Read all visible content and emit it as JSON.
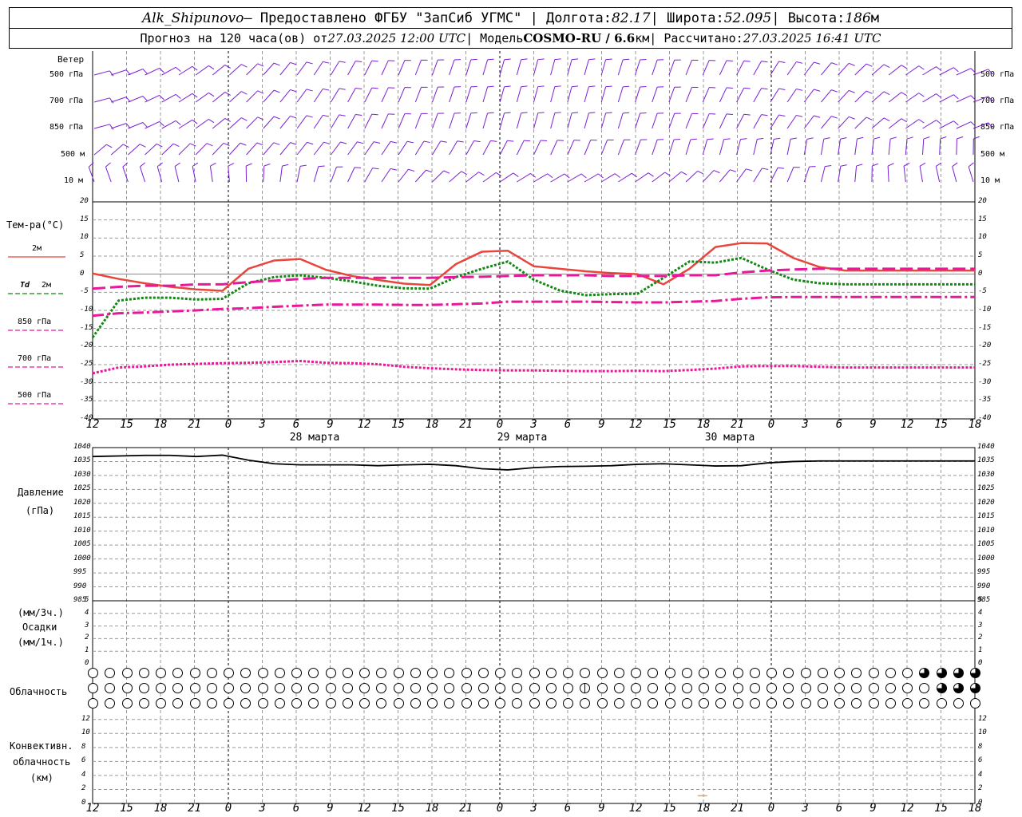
{
  "header": {
    "station": "Alk_Shipunovo",
    "provider": " – Предоставлено ФГБУ \"ЗапСиб УГМС\" | Долгота: ",
    "lon": "82.17",
    "lat_label": " | Широта: ",
    "lat": "52.095",
    "alt_label": " | Высота: ",
    "alt": "186",
    "alt_unit": "м",
    "forecast_label": "Прогноз на 120 часа(ов) от ",
    "forecast_time": "27.03.2025 12:00 UTC",
    "model_label": " | Модель ",
    "model": "COSMO-RU / 6.6",
    "model_unit": "км",
    "calc_label": " | Рассчитано: ",
    "calc_time": "27.03.2025 16:41 UTC"
  },
  "labels": {
    "wind": "Ветер",
    "wind_levels": [
      "500 гПа",
      "700 гПа",
      "850 гПа",
      "500 м",
      "10 м"
    ],
    "temp": "Тем-ра(°C)",
    "t2m": "2м",
    "td": "Td",
    "td2m": "2м",
    "t850": "850 гПа",
    "t700": "700 гПа",
    "t500": "500 гПа",
    "pressure": "Давление",
    "pressure_unit": "(гПа)",
    "precip_unit1": "(мм/3ч.)",
    "precip": "Осадки",
    "precip_unit2": "(мм/1ч.)",
    "cloud": "Облачность",
    "conv1": "Конвективн.",
    "conv2": "облачность",
    "conv3": "(км)"
  },
  "days": [
    "28 марта",
    "29 марта",
    "30 марта"
  ],
  "colors": {
    "t2m": "#e8463c",
    "td": "#118811",
    "levels": "#e8189a",
    "wind": "#7a1fd6",
    "grid": "#999999",
    "conv": "#e8a060"
  },
  "chart_data": [
    {
      "type": "line",
      "title": "Температура",
      "x": [
        12,
        15,
        18,
        21,
        24,
        27,
        30,
        33,
        36,
        39,
        42,
        45,
        48,
        51,
        54,
        57,
        60,
        63,
        66,
        69,
        72,
        75,
        78,
        81,
        84,
        87,
        90,
        93,
        96,
        99,
        102,
        105,
        108,
        111,
        114
      ],
      "xticks": [
        "12",
        "15",
        "18",
        "21",
        "0",
        "3",
        "6",
        "9",
        "12",
        "15",
        "18",
        "21",
        "0",
        "3",
        "6",
        "9",
        "12",
        "15",
        "18",
        "21",
        "0",
        "3",
        "6",
        "9",
        "12",
        "15",
        "18"
      ],
      "ylim": [
        -40,
        20
      ],
      "yticks": [
        20,
        15,
        10,
        5,
        0,
        -5,
        -10,
        -15,
        -20,
        -25,
        -30,
        -35,
        -40
      ],
      "series": [
        {
          "name": "2м",
          "values": [
            0.2,
            -1.3,
            -2.5,
            -3.5,
            -4.2,
            -4.6,
            1.5,
            3.8,
            4.2,
            1.2,
            -0.5,
            -1.6,
            -2.6,
            -3.0,
            2.8,
            6.2,
            6.5,
            2.2,
            1.5,
            0.8,
            0.3,
            0.0,
            -2.8,
            1.5,
            7.5,
            8.6,
            8.5,
            4.5,
            2.0,
            1.0,
            1.0,
            1.0,
            1.0,
            1.0,
            1.0
          ]
        },
        {
          "name": "Td 2м",
          "values": [
            -17.5,
            -7.3,
            -6.5,
            -6.5,
            -7.0,
            -6.8,
            -2.5,
            -0.8,
            -0.3,
            -1.0,
            -2.0,
            -3.2,
            -3.9,
            -4.0,
            -0.8,
            1.5,
            3.5,
            -1.5,
            -4.5,
            -5.8,
            -5.5,
            -5.4,
            -1.0,
            3.5,
            3.2,
            4.5,
            1.3,
            -1.5,
            -2.5,
            -2.8,
            -2.8,
            -2.8,
            -2.8,
            -2.8,
            -2.8
          ]
        },
        {
          "name": "850 гПа",
          "values": [
            -4.0,
            -3.5,
            -3.2,
            -3.2,
            -2.8,
            -2.8,
            -2.2,
            -1.8,
            -1.3,
            -1.0,
            -1.0,
            -1.0,
            -1.0,
            -1.0,
            -0.8,
            -0.7,
            -0.5,
            -0.3,
            -0.3,
            -0.3,
            -0.5,
            -0.5,
            -0.5,
            -0.3,
            -0.3,
            0.5,
            1.0,
            1.3,
            1.5,
            1.5,
            1.5,
            1.5,
            1.5,
            1.5,
            1.5
          ]
        },
        {
          "name": "700 гПа",
          "values": [
            -11.5,
            -10.8,
            -10.6,
            -10.3,
            -10.0,
            -9.6,
            -9.4,
            -9.0,
            -8.7,
            -8.4,
            -8.4,
            -8.4,
            -8.5,
            -8.5,
            -8.3,
            -8.1,
            -7.6,
            -7.6,
            -7.6,
            -7.6,
            -7.7,
            -7.8,
            -7.8,
            -7.6,
            -7.4,
            -6.8,
            -6.4,
            -6.3,
            -6.3,
            -6.3,
            -6.3,
            -6.3,
            -6.3,
            -6.3,
            -6.3
          ]
        },
        {
          "name": "500 гПа",
          "values": [
            -27.4,
            -25.8,
            -25.5,
            -25.0,
            -24.8,
            -24.6,
            -24.5,
            -24.3,
            -24.0,
            -24.5,
            -24.6,
            -24.9,
            -25.6,
            -26.0,
            -26.3,
            -26.5,
            -26.6,
            -26.6,
            -26.7,
            -26.8,
            -26.8,
            -26.7,
            -26.8,
            -26.5,
            -26.1,
            -25.5,
            -25.4,
            -25.4,
            -25.6,
            -25.8,
            -25.8,
            -25.8,
            -25.8,
            -25.8,
            -25.8
          ]
        }
      ]
    },
    {
      "type": "line",
      "title": "Давление",
      "x": [
        12,
        15,
        18,
        21,
        24,
        27,
        30,
        33,
        36,
        39,
        42,
        45,
        48,
        51,
        54,
        57,
        60,
        63,
        66,
        69,
        72,
        75,
        78,
        81,
        84,
        87,
        90,
        93,
        96,
        99,
        102,
        105,
        108,
        111,
        114
      ],
      "ylim": [
        985,
        1040
      ],
      "yticks": [
        1040,
        1035,
        1030,
        1025,
        1020,
        1015,
        1010,
        1005,
        1000,
        995,
        990,
        985
      ],
      "series": [
        {
          "name": "Давление",
          "values": [
            1036.8,
            1037.0,
            1037.2,
            1037.2,
            1036.8,
            1037.3,
            1035.5,
            1034.2,
            1033.8,
            1033.8,
            1033.8,
            1033.5,
            1033.8,
            1034.0,
            1033.5,
            1032.4,
            1032.0,
            1032.8,
            1033.2,
            1033.3,
            1033.5,
            1034.0,
            1034.2,
            1033.8,
            1033.4,
            1033.5,
            1034.5,
            1035.0,
            1035.2,
            1035.2,
            1035.2,
            1035.2,
            1035.2,
            1035.2,
            1035.2
          ]
        }
      ]
    },
    {
      "type": "bar",
      "title": "Осадки",
      "ylim": [
        0,
        5
      ],
      "yticks": [
        5,
        4,
        3,
        2,
        1,
        0
      ],
      "series": []
    },
    {
      "type": "scatter",
      "title": "Облачность",
      "rows": 3,
      "count": 53,
      "cover": [
        [
          0,
          0,
          0,
          0,
          0,
          0,
          0,
          0,
          0,
          0,
          0,
          0,
          0,
          0,
          0,
          0,
          0,
          0,
          0,
          0,
          0,
          0,
          0,
          0,
          0,
          0,
          0,
          0,
          0,
          0,
          0,
          0,
          0,
          0,
          0,
          0,
          0,
          0,
          0,
          0,
          0,
          0,
          0,
          0,
          0,
          0,
          0,
          0,
          0,
          3,
          3,
          3,
          3
        ],
        [
          0,
          0,
          0,
          0,
          0,
          0,
          0,
          0,
          0,
          0,
          0,
          0,
          0,
          0,
          0,
          0,
          0,
          0,
          0,
          0,
          0,
          0,
          0,
          0,
          0,
          0,
          0,
          0,
          0,
          1,
          0,
          0,
          0,
          0,
          0,
          0,
          0,
          0,
          0,
          0,
          0,
          0,
          0,
          0,
          0,
          0,
          0,
          0,
          0,
          0,
          3,
          3,
          3
        ],
        [
          0,
          0,
          0,
          0,
          0,
          0,
          0,
          0,
          0,
          0,
          0,
          0,
          0,
          0,
          0,
          0,
          0,
          0,
          0,
          0,
          0,
          0,
          0,
          0,
          0,
          0,
          0,
          0,
          0,
          0,
          0,
          0,
          0,
          0,
          0,
          0,
          0,
          0,
          0,
          0,
          0,
          0,
          0,
          0,
          0,
          0,
          0,
          0,
          0,
          0,
          0,
          0,
          0
        ]
      ]
    },
    {
      "type": "bar",
      "title": "Конвективная облачность",
      "ylim": [
        0,
        13
      ],
      "yticks": [
        12,
        10,
        8,
        6,
        4,
        2,
        0
      ],
      "values": [
        {
          "x": 82.5,
          "y": 1.1
        }
      ]
    }
  ]
}
